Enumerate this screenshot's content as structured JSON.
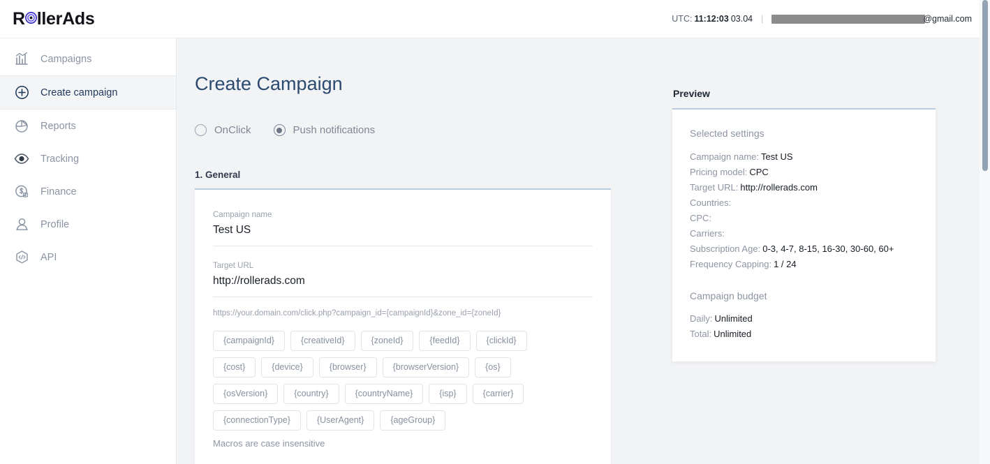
{
  "header": {
    "logo_text_1": "R",
    "logo_icon": "bullseye-target-icon",
    "logo_text_2": "llerAds",
    "utc_label": "UTC:",
    "utc_time": "11:12:03",
    "utc_date": "03.04",
    "separator": "|",
    "email_redacted": true,
    "email_tail": "@gmail.com"
  },
  "sidebar": {
    "items": [
      {
        "label": "Campaigns",
        "icon": "bar-chart-icon",
        "active": false
      },
      {
        "label": "Create campaign",
        "icon": "plus-circle-icon",
        "active": true
      },
      {
        "label": "Reports",
        "icon": "pie-chart-icon",
        "active": false
      },
      {
        "label": "Tracking",
        "icon": "eye-icon",
        "active": false
      },
      {
        "label": "Finance",
        "icon": "dollar-coin-icon",
        "active": false
      },
      {
        "label": "Profile",
        "icon": "user-icon",
        "active": false
      },
      {
        "label": "API",
        "icon": "code-hexagon-icon",
        "active": false
      }
    ]
  },
  "main": {
    "page_title": "Create Campaign",
    "campaign_types": [
      {
        "label": "OnClick",
        "selected": false
      },
      {
        "label": "Push notifications",
        "selected": true
      }
    ],
    "section_heading": "1. General",
    "form": {
      "campaign_name_label": "Campaign name",
      "campaign_name_value": "Test US",
      "target_url_label": "Target URL",
      "target_url_value": "http://rollerads.com",
      "url_hint": "https://your.domain.com/click.php?campaign_id={campaignId}&zone_id={zoneId}",
      "macro_rows": [
        [
          "{campaignId}",
          "{creativeId}",
          "{zoneId}",
          "{feedId}",
          "{clickId}"
        ],
        [
          "{cost}",
          "{device}",
          "{browser}",
          "{browserVersion}",
          "{os}"
        ],
        [
          "{osVersion}",
          "{country}",
          "{countryName}",
          "{isp}",
          "{carrier}"
        ],
        [
          "{connectionType}",
          "{UserAgent}",
          "{ageGroup}"
        ]
      ],
      "macro_note": "Macros are case insensitive"
    }
  },
  "preview": {
    "title": "Preview",
    "selected_settings_heading": "Selected settings",
    "settings": [
      {
        "key": "Campaign name:",
        "value": "Test US"
      },
      {
        "key": "Pricing model:",
        "value": "CPC"
      },
      {
        "key": "Target URL:",
        "value": "http://rollerads.com"
      },
      {
        "key": "Countries:",
        "value": ""
      },
      {
        "key": "CPC:",
        "value": ""
      },
      {
        "key": "Carriers:",
        "value": ""
      },
      {
        "key": "Subscription Age:",
        "value": "0-3, 4-7, 8-15, 16-30, 30-60, 60+"
      },
      {
        "key": "Frequency Capping:",
        "value": "1 / 24"
      }
    ],
    "budget_heading": "Campaign budget",
    "budget": [
      {
        "key": "Daily:",
        "value": "Unlimited"
      },
      {
        "key": "Total:",
        "value": "Unlimited"
      }
    ]
  },
  "colors": {
    "accent_border": "#b9cbdd",
    "logo_ring": "#4b3fd6",
    "page_bg": "#f2f3f5",
    "title_color": "#2b4a70"
  }
}
